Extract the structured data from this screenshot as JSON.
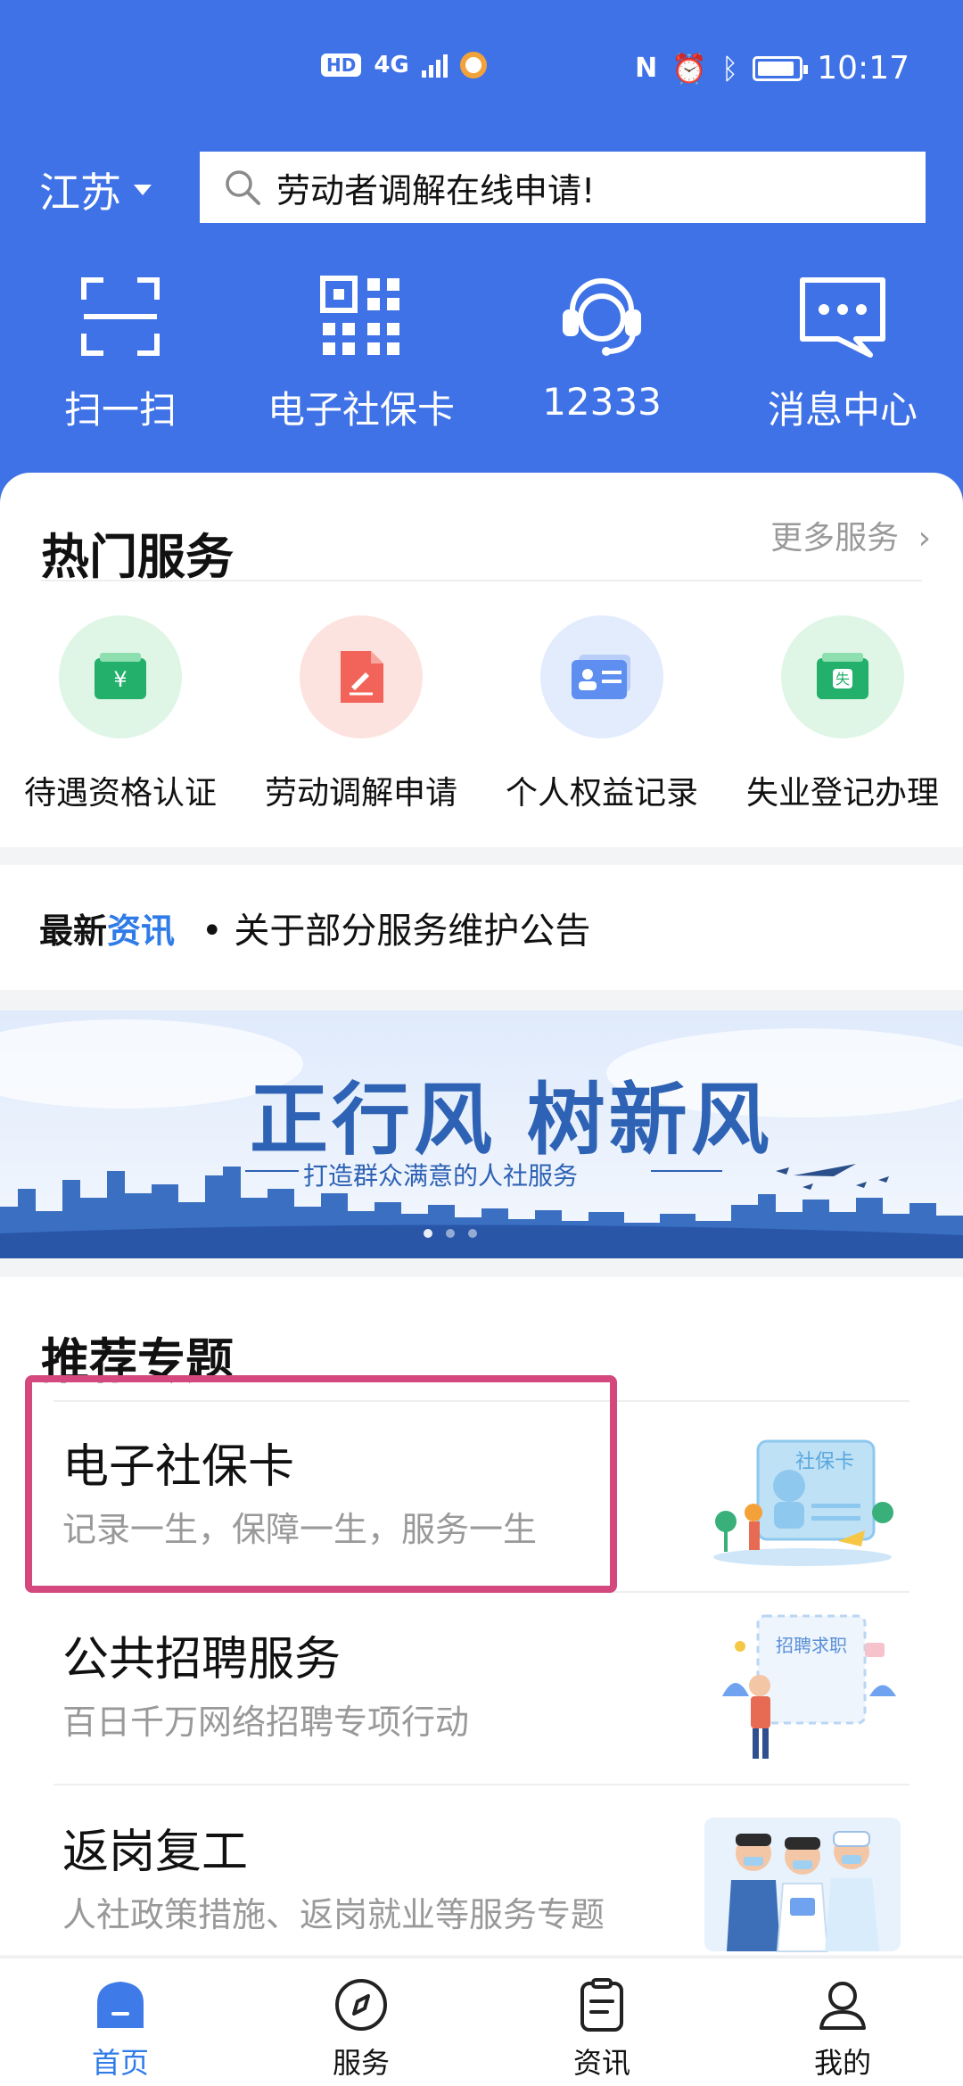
{
  "status_bar": {
    "hd": "HD",
    "network": "4G",
    "time": "10:17"
  },
  "header": {
    "region": "江苏",
    "search_text": "劳动者调解在线申请!",
    "quick_actions": [
      {
        "label": "扫一扫",
        "icon": "scan-icon"
      },
      {
        "label": "电子社保卡",
        "icon": "qr-code-icon"
      },
      {
        "label": "12333",
        "icon": "customer-service-icon"
      },
      {
        "label": "消息中心",
        "icon": "message-icon"
      }
    ]
  },
  "hot_services": {
    "title": "热门服务",
    "more": "更多服务",
    "items": [
      {
        "label": "待遇资格认证",
        "icon": "wallet-icon",
        "color": "#22b06b",
        "bg": "#dff6e6"
      },
      {
        "label": "劳动调解申请",
        "icon": "document-sign-icon",
        "color": "#f2645a",
        "bg": "#fde3df"
      },
      {
        "label": "个人权益记录",
        "icon": "id-card-icon",
        "color": "#5d8ef0",
        "bg": "#e2ecfd"
      },
      {
        "label": "失业登记办理",
        "icon": "unemployment-icon",
        "color": "#22b06b",
        "bg": "#dff6e6"
      }
    ]
  },
  "news": {
    "brand_a": "最新",
    "brand_b": "资讯",
    "item": "• 关于部分服务维护公告"
  },
  "banner": {
    "slogan": "正行风 树新风",
    "subtitle": "打造群众满意的人社服务"
  },
  "recommend": {
    "title": "推荐专题",
    "items": [
      {
        "title": "电子社保卡",
        "subtitle": "记录一生，保障一生，服务一生",
        "pic_text": "社保卡"
      },
      {
        "title": "公共招聘服务",
        "subtitle": "百日千万网络招聘专项行动",
        "pic_text": "招聘求职"
      },
      {
        "title": "返岗复工",
        "subtitle": "人社政策措施、返岗就业等服务专题",
        "pic_text": ""
      }
    ]
  },
  "tabbar": [
    {
      "label": "首页",
      "icon": "home-icon",
      "active": true
    },
    {
      "label": "服务",
      "icon": "compass-icon",
      "active": false
    },
    {
      "label": "资讯",
      "icon": "news-icon",
      "active": false
    },
    {
      "label": "我的",
      "icon": "profile-icon",
      "active": false
    }
  ],
  "colors": {
    "primary": "#3f72e6",
    "accent": "#2f7be8",
    "highlight_border": "#d4487e"
  }
}
